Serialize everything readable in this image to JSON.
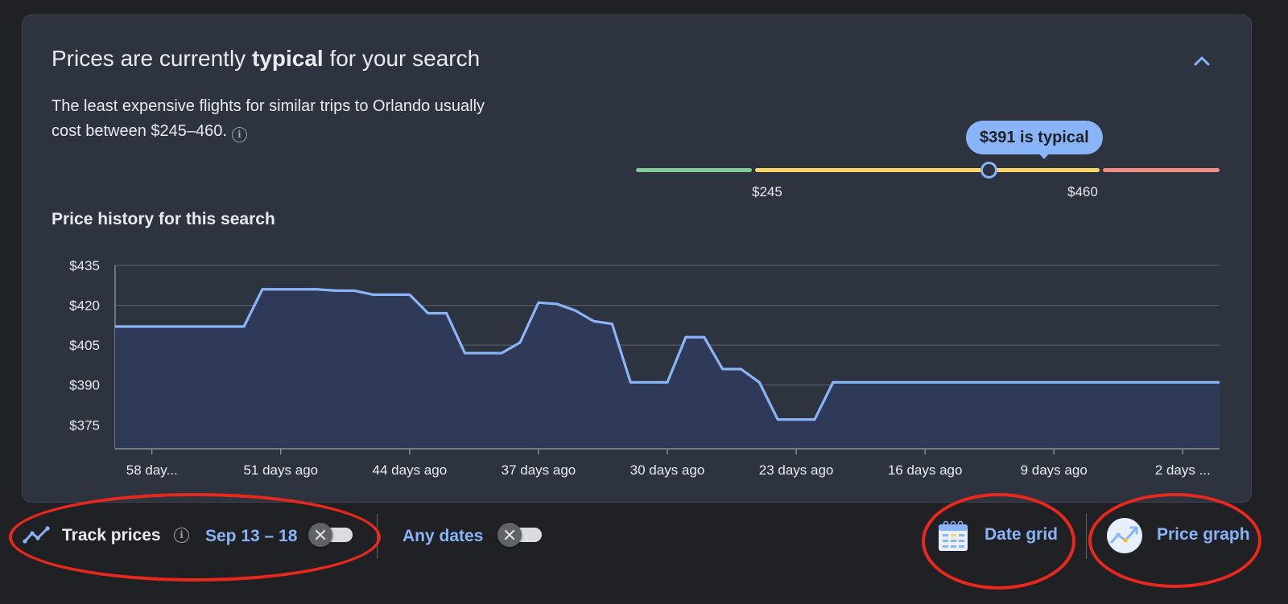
{
  "insight": {
    "headline_prefix": "Prices are currently",
    "headline_bold": "typical",
    "headline_suffix": "for your search",
    "description": "The least expensive flights for similar trips to Orlando usually cost between $245–460.",
    "info_glyph": "i",
    "collapse_icon": "chevron-up-icon"
  },
  "price_range": {
    "current_label": "$391 is typical",
    "low_label": "$245",
    "high_label": "$460",
    "low": 245,
    "high": 460,
    "current": 391,
    "colors": {
      "low": "#81c995",
      "typical": "#fdd663",
      "high": "#f28b82",
      "marker": "#8ab4f8"
    }
  },
  "history": {
    "title": "Price history for this search"
  },
  "chart_data": {
    "type": "area",
    "title": "Price history for this search",
    "xlabel": "",
    "ylabel": "",
    "y_ticks": [
      "$435",
      "$420",
      "$405",
      "$390",
      "$375"
    ],
    "y_tick_values": [
      435,
      420,
      405,
      390,
      375
    ],
    "x_ticks": [
      "58 day...",
      "51 days ago",
      "44 days ago",
      "37 days ago",
      "30 days ago",
      "23 days ago",
      "16 days ago",
      "9 days ago",
      "2 days ..."
    ],
    "x_tick_days_ago": [
      58,
      51,
      44,
      37,
      30,
      23,
      16,
      9,
      2
    ],
    "xlim": [
      60,
      0
    ],
    "ylim": [
      366,
      435
    ],
    "grid": true,
    "line_color": "#8ab4f8",
    "fill_color": "#2e3a57",
    "series": [
      {
        "points": [
          [
            60,
            412
          ],
          [
            53,
            412
          ],
          [
            52,
            426
          ],
          [
            50,
            426
          ],
          [
            49,
            426
          ],
          [
            48,
            425.5
          ],
          [
            47,
            425.5
          ],
          [
            46,
            424
          ],
          [
            44,
            424
          ],
          [
            43,
            417
          ],
          [
            42,
            417
          ],
          [
            41,
            402
          ],
          [
            39,
            402
          ],
          [
            38,
            406
          ],
          [
            37,
            421
          ],
          [
            36,
            420.5
          ],
          [
            35,
            418
          ],
          [
            34,
            414
          ],
          [
            33,
            413
          ],
          [
            32,
            391
          ],
          [
            30,
            391
          ],
          [
            29,
            408
          ],
          [
            28,
            408
          ],
          [
            27,
            396
          ],
          [
            26,
            396
          ],
          [
            25,
            391
          ],
          [
            24,
            377
          ],
          [
            22,
            377
          ],
          [
            21,
            391
          ],
          [
            0,
            391
          ]
        ]
      }
    ]
  },
  "bottom_bar": {
    "track_icon": "trend-line-icon",
    "track_label": "Track prices",
    "info_glyph": "i",
    "dates_label": "Sep 13 – 18",
    "any_dates_label": "Any dates",
    "date_grid_icon": "calendar-grid-icon",
    "date_grid_label": "Date grid",
    "price_graph_icon": "price-graph-icon",
    "price_graph_label": "Price graph",
    "link_color": "#8ab4f8",
    "annotation_color": "#e8281c"
  }
}
